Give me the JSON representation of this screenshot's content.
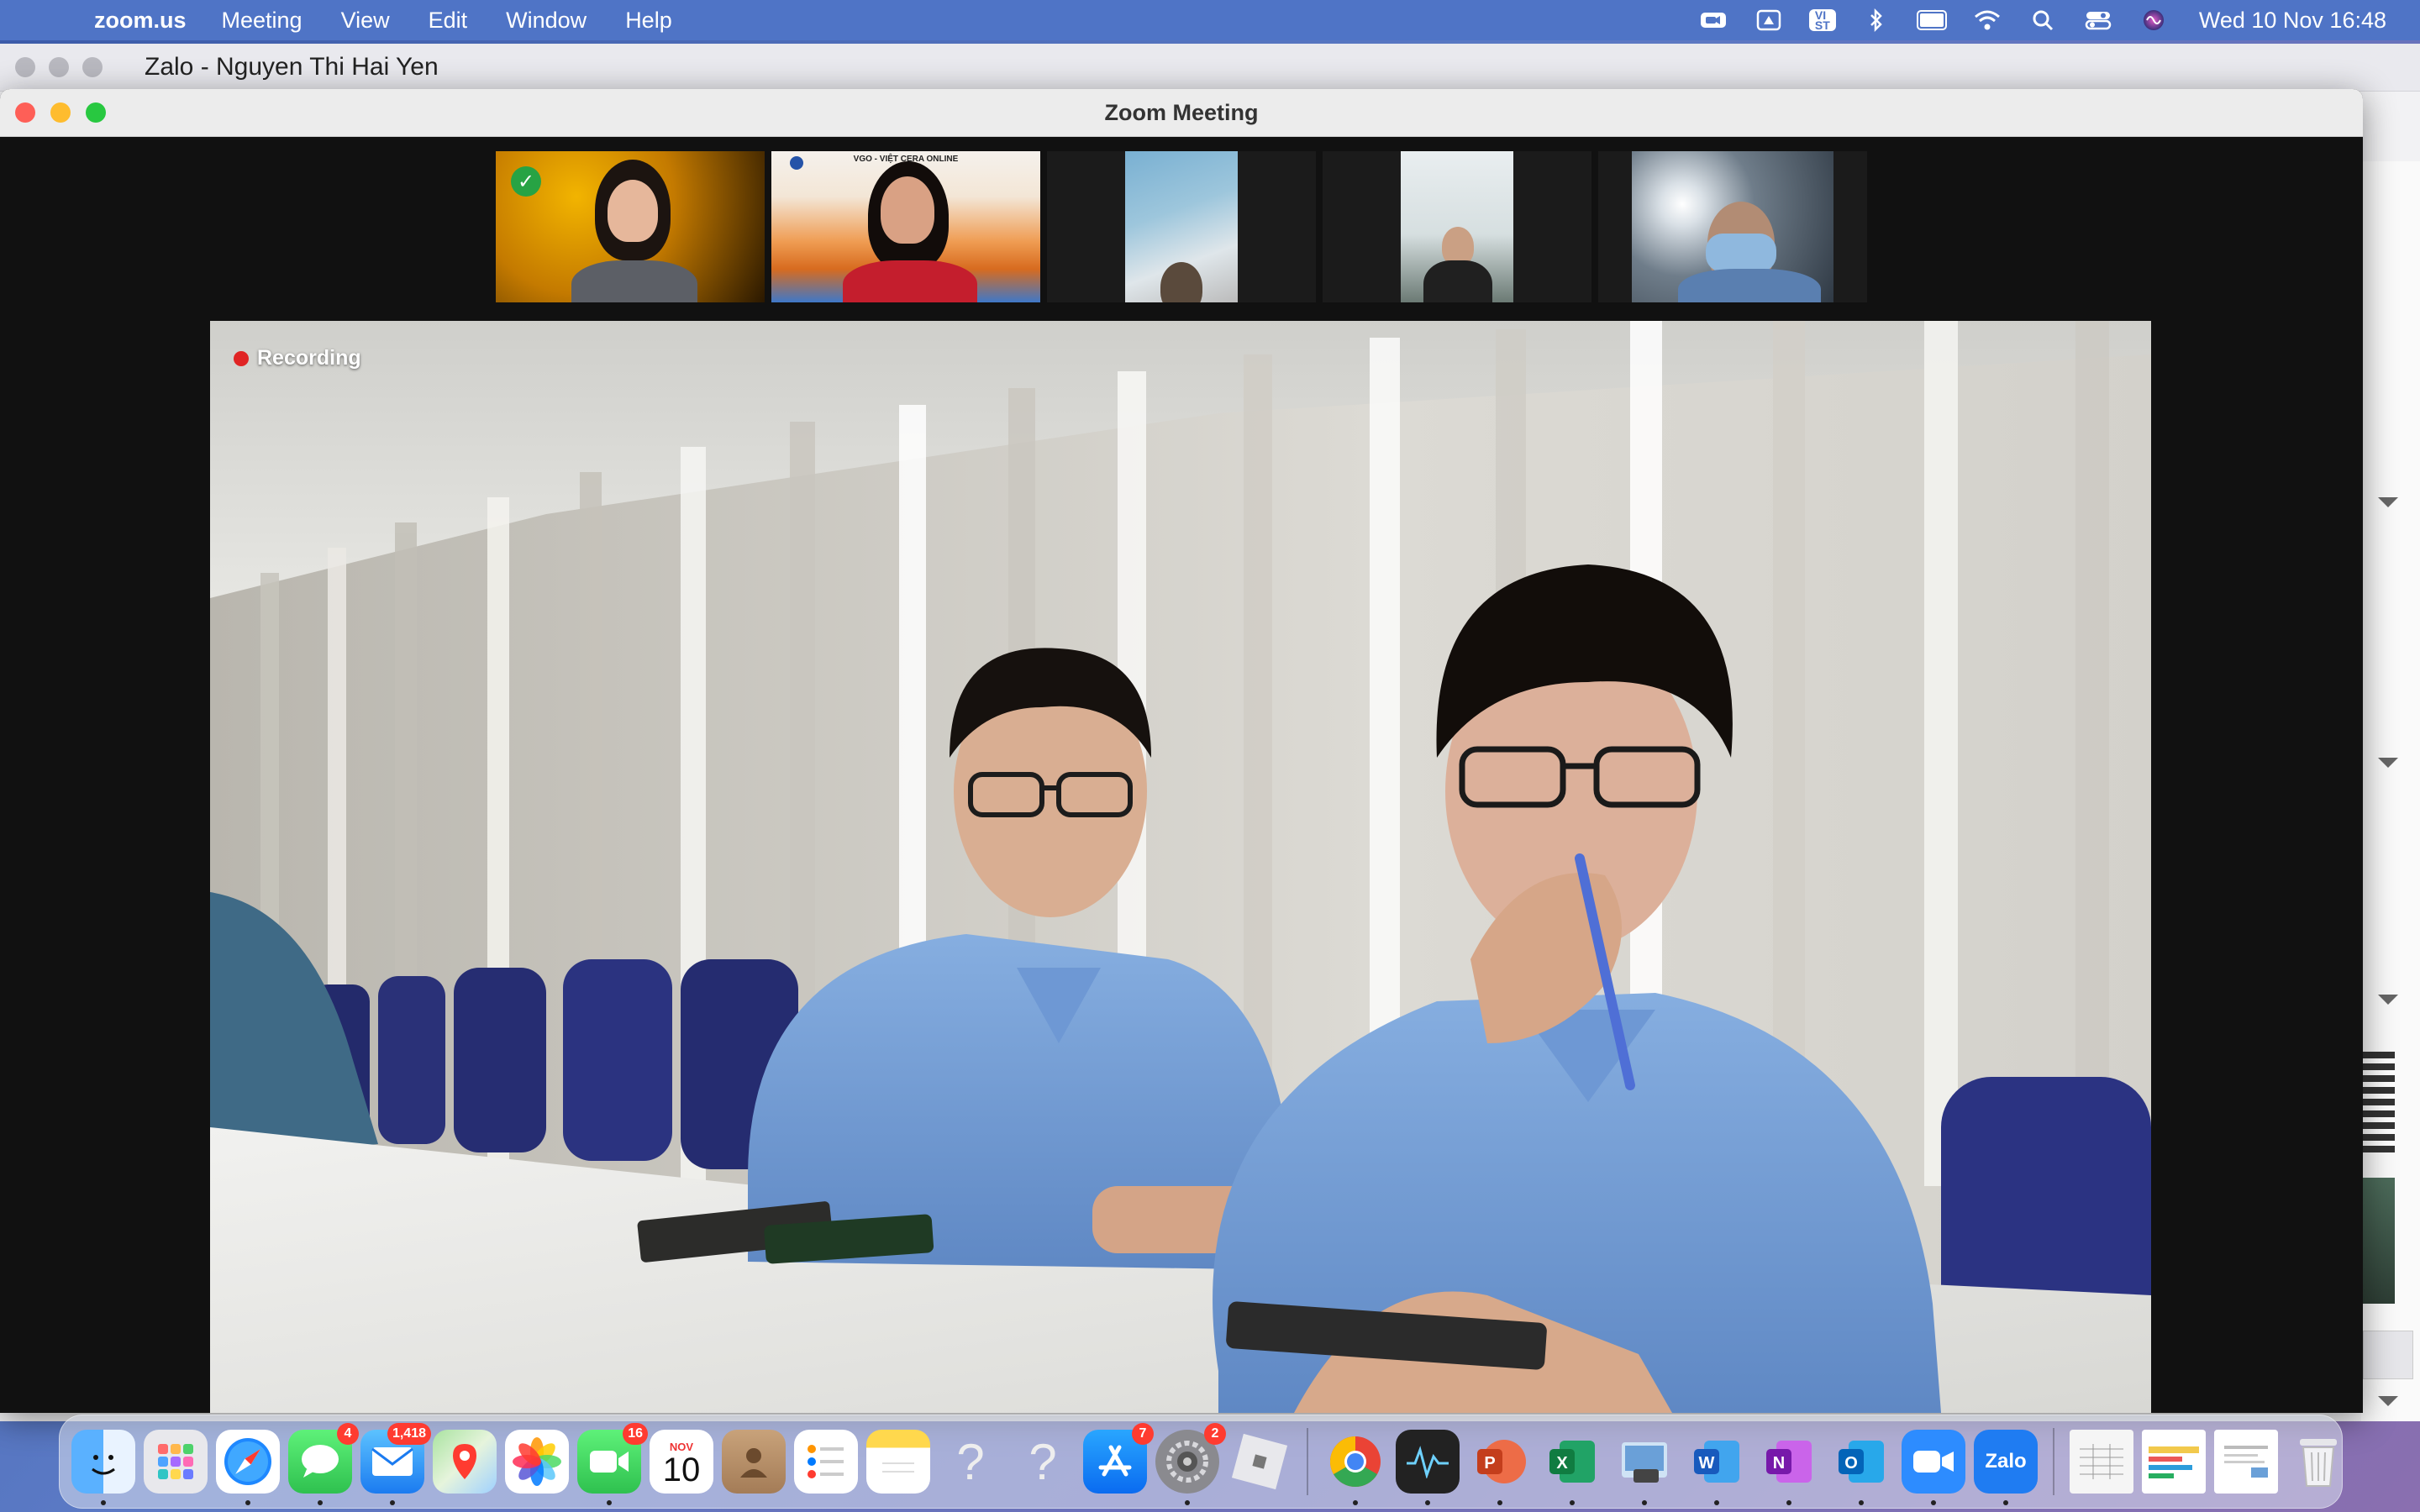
{
  "menubar": {
    "app_name": "zoom.us",
    "menus": [
      "Meeting",
      "View",
      "Edit",
      "Window",
      "Help"
    ],
    "clock": "Wed 10 Nov  16:48",
    "input_source": "VI\nST"
  },
  "zalo": {
    "window_title": "Zalo - Nguyen Thi Hai Yen"
  },
  "zoom": {
    "window_title": "Zoom Meeting",
    "recording_label": "Recording",
    "gallery_banner": "VGO - VIỆT CERA ONLINE"
  },
  "dock": {
    "badges": {
      "messages": "4",
      "mail": "1,418",
      "facetime": "16",
      "appstore": "7",
      "settings": "2"
    },
    "calendar": {
      "month": "NOV",
      "day": "10"
    },
    "zalo_label": "Zalo"
  }
}
